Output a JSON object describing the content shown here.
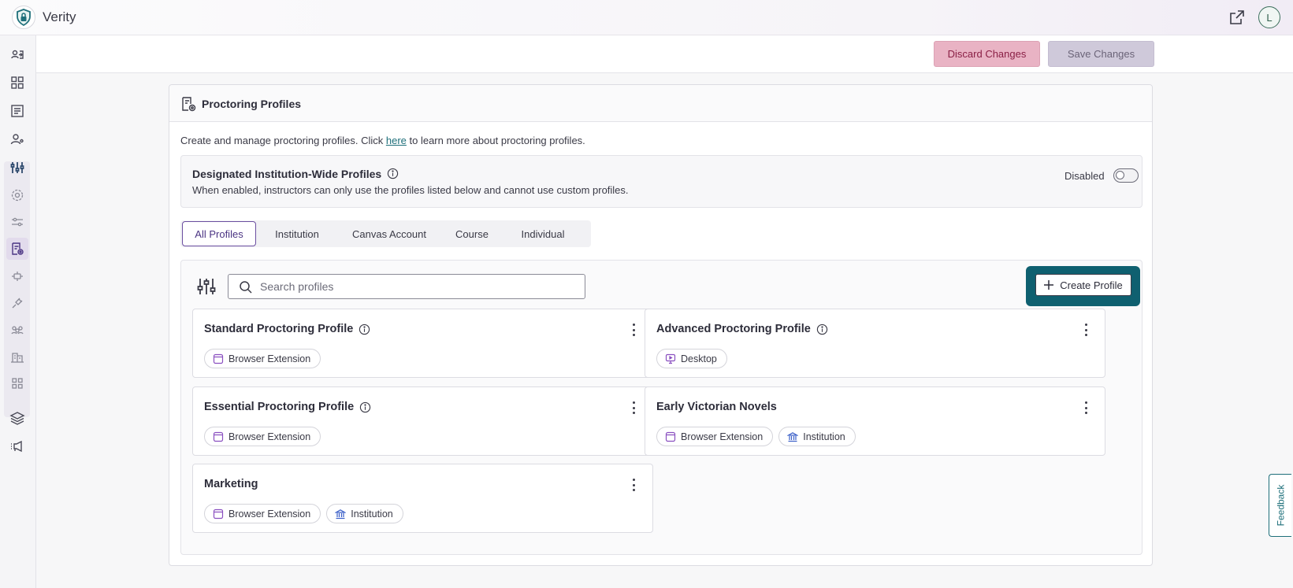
{
  "app": {
    "title": "Verity",
    "avatar_initial": "L",
    "accent": "#0f6070"
  },
  "sidebar": {
    "items": [
      {
        "icon": "user-switch-icon"
      },
      {
        "icon": "dashboard-grid-icon"
      },
      {
        "icon": "reports-icon"
      },
      {
        "icon": "user-search-icon"
      },
      {
        "icon": "sliders-icon"
      },
      {
        "icon": "gear-icon"
      },
      {
        "icon": "filters-icon"
      },
      {
        "icon": "proctoring-profiles-icon"
      },
      {
        "icon": "integrations-icon"
      },
      {
        "icon": "plug-icon"
      },
      {
        "icon": "group-icon"
      },
      {
        "icon": "institution-icon"
      },
      {
        "icon": "apps-icon"
      },
      {
        "icon": "layers-icon"
      },
      {
        "icon": "announcements-icon"
      }
    ]
  },
  "actions": {
    "discard_label": "Discard Changes",
    "save_label": "Save Changes"
  },
  "page": {
    "title": "Proctoring Profiles",
    "intro_before": "Create and manage proctoring profiles. Click ",
    "intro_link": "here",
    "intro_after": " to learn more about proctoring profiles."
  },
  "designated": {
    "title": "Designated Institution-Wide Profiles",
    "description": "When enabled, instructors can only use the profiles listed below and cannot use custom profiles.",
    "toggle_label": "Disabled",
    "enabled": false
  },
  "tabs": [
    {
      "label": "All Profiles",
      "active": true
    },
    {
      "label": "Institution",
      "active": false
    },
    {
      "label": "Canvas Account",
      "active": false
    },
    {
      "label": "Course",
      "active": false
    },
    {
      "label": "Individual",
      "active": false
    }
  ],
  "search": {
    "placeholder": "Search profiles"
  },
  "create_button_label": "Create Profile",
  "profiles": [
    {
      "name": "Standard Proctoring Profile",
      "info": true,
      "tags": [
        "Browser Extension"
      ]
    },
    {
      "name": "Advanced Proctoring Profile",
      "info": true,
      "tags": [
        "Desktop"
      ]
    },
    {
      "name": "Essential Proctoring Profile",
      "info": true,
      "tags": [
        "Browser Extension"
      ]
    },
    {
      "name": "Early Victorian Novels",
      "info": false,
      "tags": [
        "Browser Extension",
        "Institution"
      ]
    },
    {
      "name": "Marketing",
      "info": false,
      "tags": [
        "Browser Extension",
        "Institution"
      ]
    }
  ],
  "feedback_label": "Feedback"
}
